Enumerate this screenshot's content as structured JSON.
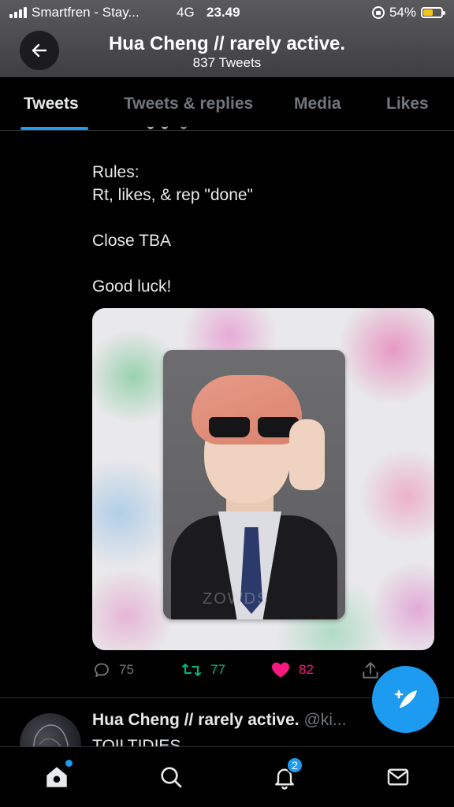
{
  "status_bar": {
    "carrier": "Smartfren - Stay...",
    "network": "4G",
    "time": "23.49",
    "battery": "54%",
    "battery_level": 0.54
  },
  "header": {
    "title": "Hua Cheng // rarely active.",
    "subtitle": "837 Tweets",
    "back_icon": "arrow-left-icon"
  },
  "tabs": [
    {
      "label": "Tweets",
      "active": true
    },
    {
      "label": "Tweets & replies",
      "active": false
    },
    {
      "label": "Media",
      "active": false
    },
    {
      "label": "Likes",
      "active": false
    }
  ],
  "tweet": {
    "lines": [
      "Rules:",
      "Rt, likes, & rep \"done\"",
      "Close TBA",
      "Good luck!"
    ],
    "image_watermark": "ZOWDS",
    "actions": {
      "replies": "75",
      "retweets": "77",
      "likes": "82"
    }
  },
  "next_tweet": {
    "name": "Hua Cheng // rarely active.",
    "handle": "@ki...",
    "text": "TOILTIDIES"
  },
  "bottom_nav": {
    "items": [
      "home-icon",
      "search-icon",
      "bell-icon",
      "mail-icon"
    ],
    "notifications_badge": "2"
  },
  "colors": {
    "accent": "#1d9bf0",
    "retweet": "#00ba7c",
    "like": "#f91880",
    "muted": "#71767b",
    "battery": "#f5c518"
  }
}
